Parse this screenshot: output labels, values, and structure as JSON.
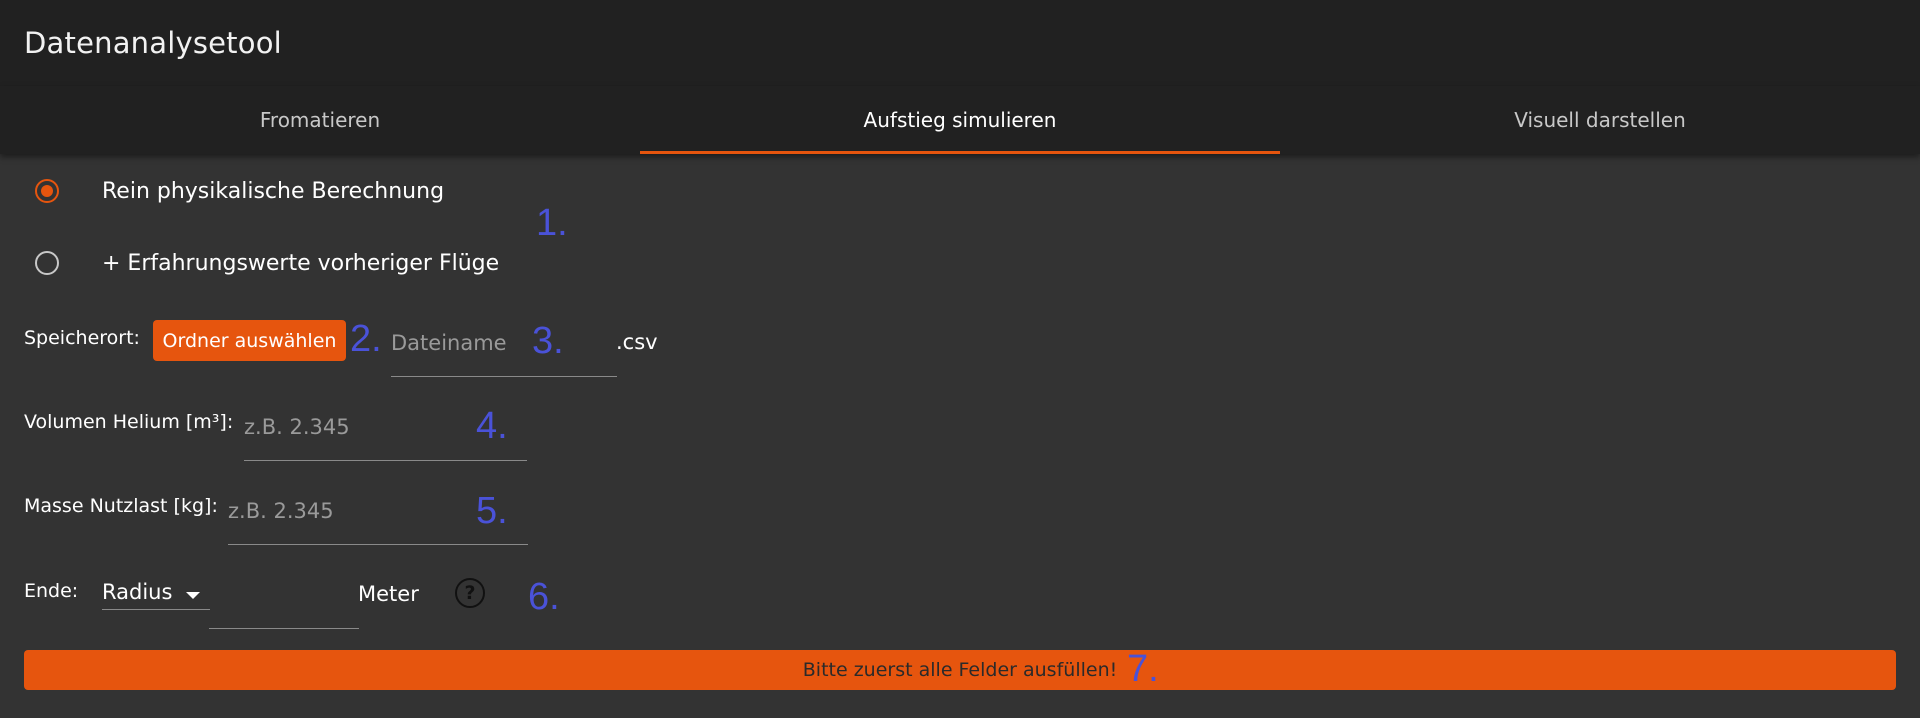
{
  "window": {
    "title": "Datenanalysetool"
  },
  "tabs": [
    {
      "label": "Fromatieren",
      "active": false
    },
    {
      "label": "Aufstieg simulieren",
      "active": true
    },
    {
      "label": "Visuell darstellen",
      "active": false
    }
  ],
  "calc_mode": {
    "options": [
      {
        "label": "Rein physikalische Berechnung",
        "checked": true
      },
      {
        "label": "+ Erfahrungswerte vorheriger Flüge",
        "checked": false
      }
    ],
    "annotation": "1."
  },
  "save_location": {
    "label": "Speicherort:",
    "button_label": "Ordner auswählen",
    "button_annotation": "2.",
    "filename_placeholder": "Dateiname",
    "filename_value": "",
    "filename_annotation": "3.",
    "extension": ".csv"
  },
  "helium_volume": {
    "label": "Volumen Helium [m³]:",
    "placeholder": "z.B. 2.345",
    "value": "",
    "annotation": "4."
  },
  "payload_mass": {
    "label": "Masse Nutzlast [kg]:",
    "placeholder": "z.B. 2.345",
    "value": "",
    "annotation": "5."
  },
  "end_condition": {
    "label": "Ende:",
    "selected": "Radius",
    "value": "",
    "unit": "Meter",
    "help_icon": "help-circle-icon",
    "help_glyph": "?",
    "annotation": "6."
  },
  "submit": {
    "label": "Bitte zuerst alle Felder ausfüllen!",
    "annotation": "7."
  },
  "colors": {
    "accent": "#e6550e",
    "annotation": "#4a52d8",
    "background": "#333333",
    "header": "#212121"
  }
}
